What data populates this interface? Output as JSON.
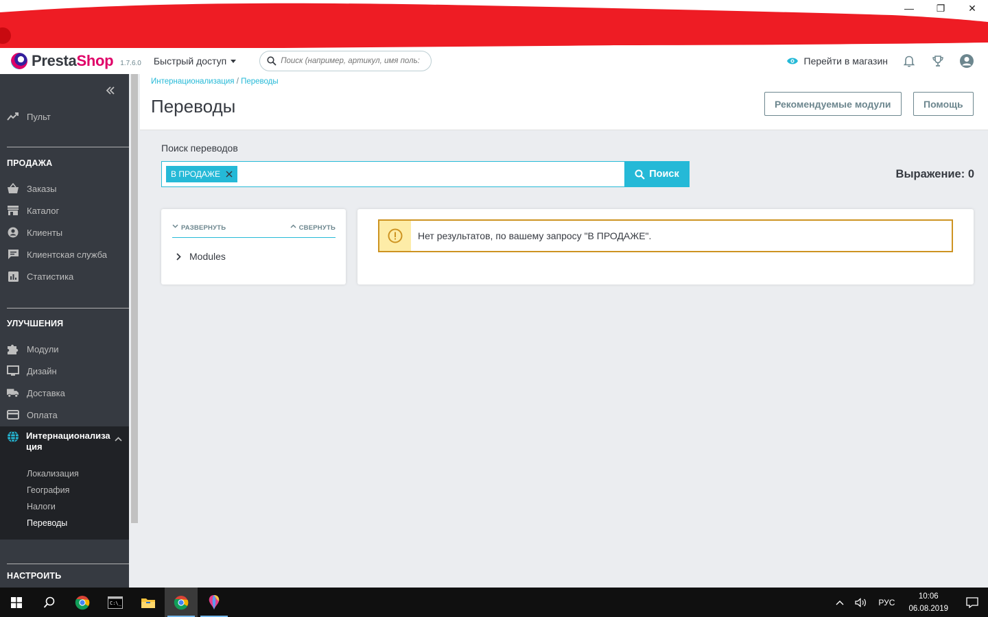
{
  "window": {
    "minimize_glyph": "—",
    "maximize_glyph": "❐",
    "close_glyph": "✕"
  },
  "header": {
    "logo_part1": "Presta",
    "logo_part2": "Shop",
    "version": "1.7.6.0",
    "quick_access": "Быстрый доступ",
    "search_placeholder": "Поиск (например, артикул, имя поль:",
    "view_shop": "Перейти в магазин"
  },
  "sidebar": {
    "dashboard": "Пульт",
    "section_sell": "ПРОДАЖА",
    "sell_items": [
      "Заказы",
      "Каталог",
      "Клиенты",
      "Клиентская служба",
      "Статистика"
    ],
    "section_improve": "УЛУЧШЕНИЯ",
    "improve_items": [
      "Модули",
      "Дизайн",
      "Доставка",
      "Оплата"
    ],
    "active_item": "Интернационализация",
    "sub_items": [
      "Локализация",
      "География",
      "Налоги",
      "Переводы"
    ],
    "section_configure": "НАСТРОИТЬ"
  },
  "page": {
    "breadcrumb_parent": "Интернационализация",
    "breadcrumb_sep": "/",
    "breadcrumb_current": "Переводы",
    "title": "Переводы",
    "btn_modules": "Рекомендуемые модули",
    "btn_help": "Помощь"
  },
  "search": {
    "label": "Поиск переводов",
    "tag": "В ПРОДАЖЕ",
    "button": "Поиск",
    "expression": "Выражение: 0"
  },
  "tree": {
    "expand": "РАЗВЕРНУТЬ",
    "collapse": "СВЕРНУТЬ",
    "node": "Modules"
  },
  "result": {
    "message": "Нет результатов, по вашему запросу \"В ПРОДАЖЕ\"."
  },
  "taskbar": {
    "lang": "РУС",
    "time": "10:06",
    "date": "06.08.2019"
  },
  "colors": {
    "accent": "#25b9d7",
    "sidebar_bg": "#363a41",
    "sidebar_active_bg": "#202226",
    "warning_border": "#cd9321",
    "warning_bg": "#fdeca7",
    "brand_pink": "#df0067"
  }
}
